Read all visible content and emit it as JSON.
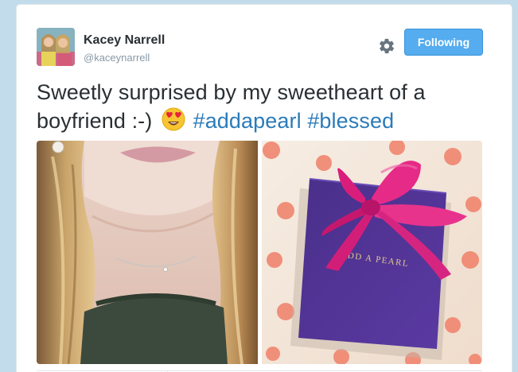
{
  "user": {
    "display_name": "Kacey Narrell",
    "screen_name": "@kaceynarrell"
  },
  "actions": {
    "follow_label": "Following",
    "settings_icon": "gear-icon"
  },
  "tweet": {
    "text_line1": "Sweetly surprised by my sweetheart of a",
    "text_line2": "boyfriend :-)",
    "emoji": "smiling-face-with-heart-eyes",
    "hashtag1": "#addapearl",
    "hashtag2": "#blessed"
  },
  "media": {
    "box_brand_text": "ADD A PEARL"
  },
  "colors": {
    "accent": "#55acee",
    "hashtag": "#2b7bb9",
    "text": "#292f33",
    "muted": "#8899a6",
    "background": "#c3dceb"
  }
}
